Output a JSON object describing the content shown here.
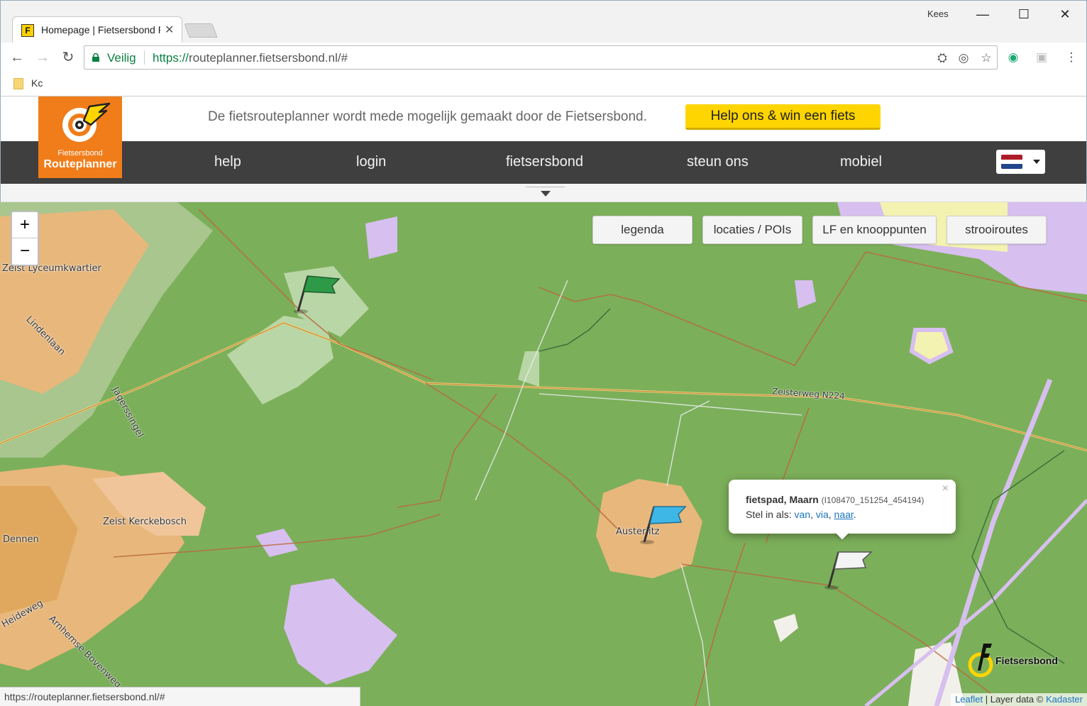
{
  "browser": {
    "tab_title": "Homepage | Fietsersbond Routeplanner",
    "tab_favicon": "F",
    "user": "Kees",
    "secure_label": "Veilig",
    "url_scheme": "https://",
    "url_host": "routeplanner.fietsersbond.nl",
    "url_path": "/#",
    "bookmark": "Kc",
    "status_url": "https://routeplanner.fietsersbond.nl/#"
  },
  "site": {
    "logo_line1": "Fietsersbond",
    "logo_line2": "Routeplanner",
    "sponsor_text": "De fietsrouteplanner wordt mede mogelijk gemaakt door de Fietsersbond.",
    "cta_label": "Help ons & win een fiets",
    "nav": [
      "help",
      "login",
      "fietsersbond",
      "steun ons",
      "mobiel"
    ],
    "language": "Nederlands",
    "colors": {
      "brand_orange": "#f07d1a",
      "cta_yellow": "#ffd500",
      "nav_dark": "#3f3f3f"
    }
  },
  "map": {
    "buttons": [
      "legenda",
      "locaties / POIs",
      "LF en knooppunten",
      "strooiroutes"
    ],
    "zoom_in": "+",
    "zoom_out": "−",
    "labels": {
      "lyceum": "Zeist Lyceumkwartier",
      "lindenlaan": "Lindenlaan",
      "jagerssingel": "Jagerssingel",
      "zeisterweg": "Zeisterweg N224",
      "kerckebosch": "Zeist Kerckebosch",
      "dennen": "Dennen",
      "heideweg": "Heideweg",
      "arnhemse": "Arnhemse Bovenweg",
      "austerlitz": "Austerlitz"
    },
    "popup": {
      "title": "fietspad, Maarn",
      "id": "(I108470_151254_454194)",
      "set_as": "Stel in als:",
      "options": [
        "van",
        "via",
        "naar"
      ],
      "close": "×"
    },
    "brand": "Fietsersbond",
    "attribution": {
      "leaflet": "Leaflet",
      "layer": " | Layer data © ",
      "source": "Kadaster"
    }
  }
}
